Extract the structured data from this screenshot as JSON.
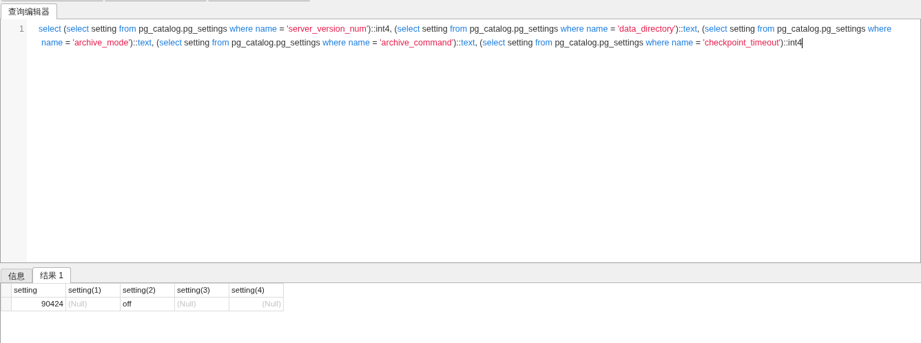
{
  "editor_tabs": [
    {
      "label": "查询编辑器",
      "selected": true
    }
  ],
  "editor": {
    "line_numbers": [
      "1"
    ],
    "lines": [
      [
        {
          "kind": "keyword",
          "text": "select"
        },
        {
          "kind": "plain",
          "text": " ("
        },
        {
          "kind": "keyword",
          "text": "select"
        },
        {
          "kind": "plain",
          "text": " setting "
        },
        {
          "kind": "keyword",
          "text": "from"
        },
        {
          "kind": "plain",
          "text": " pg_catalog.pg_settings "
        },
        {
          "kind": "keyword",
          "text": "where name"
        },
        {
          "kind": "plain",
          "text": " = "
        },
        {
          "kind": "string",
          "text": "'server_version_num'"
        },
        {
          "kind": "plain",
          "text": ")::int4, ("
        },
        {
          "kind": "keyword",
          "text": "select"
        },
        {
          "kind": "plain",
          "text": " setting "
        },
        {
          "kind": "keyword",
          "text": "from"
        },
        {
          "kind": "plain",
          "text": " pg_catalog.pg_settings "
        },
        {
          "kind": "keyword",
          "text": "where name"
        },
        {
          "kind": "plain",
          "text": " = "
        },
        {
          "kind": "string",
          "text": "'data_directory'"
        },
        {
          "kind": "plain",
          "text": ")::"
        },
        {
          "kind": "keyword",
          "text": "text"
        },
        {
          "kind": "plain",
          "text": ", ("
        },
        {
          "kind": "keyword",
          "text": "select"
        },
        {
          "kind": "plain",
          "text": " setting "
        },
        {
          "kind": "keyword",
          "text": "from"
        },
        {
          "kind": "plain",
          "text": " pg_catalog.pg_settings "
        },
        {
          "kind": "keyword",
          "text": "where"
        }
      ],
      [
        {
          "kind": "keyword",
          "text": "name"
        },
        {
          "kind": "plain",
          "text": " = "
        },
        {
          "kind": "string",
          "text": "'archive_mode'"
        },
        {
          "kind": "plain",
          "text": ")::"
        },
        {
          "kind": "keyword",
          "text": "text"
        },
        {
          "kind": "plain",
          "text": ", ("
        },
        {
          "kind": "keyword",
          "text": "select"
        },
        {
          "kind": "plain",
          "text": " setting "
        },
        {
          "kind": "keyword",
          "text": "from"
        },
        {
          "kind": "plain",
          "text": " pg_catalog.pg_settings "
        },
        {
          "kind": "keyword",
          "text": "where name"
        },
        {
          "kind": "plain",
          "text": " = "
        },
        {
          "kind": "string",
          "text": "'archive_command'"
        },
        {
          "kind": "plain",
          "text": ")::"
        },
        {
          "kind": "keyword",
          "text": "text"
        },
        {
          "kind": "plain",
          "text": ", ("
        },
        {
          "kind": "keyword",
          "text": "select"
        },
        {
          "kind": "plain",
          "text": " setting "
        },
        {
          "kind": "keyword",
          "text": "from"
        },
        {
          "kind": "plain",
          "text": " pg_catalog.pg_settings "
        },
        {
          "kind": "keyword",
          "text": "where name"
        },
        {
          "kind": "plain",
          "text": " = "
        },
        {
          "kind": "string",
          "text": "'checkpoint_timeout'"
        },
        {
          "kind": "plain",
          "text": ")::int4"
        }
      ]
    ]
  },
  "result_tabs": [
    {
      "label": "信息",
      "selected": false
    },
    {
      "label": "结果 1",
      "selected": true
    }
  ],
  "table": {
    "columns": [
      {
        "label": "setting",
        "kind": "numeric"
      },
      {
        "label": "setting(1)",
        "kind": "text"
      },
      {
        "label": "setting(2)",
        "kind": "text"
      },
      {
        "label": "setting(3)",
        "kind": "text"
      },
      {
        "label": "setting(4)",
        "kind": "numeric"
      }
    ],
    "rows": [
      [
        {
          "text": "90424",
          "null": false
        },
        {
          "text": "(Null)",
          "null": true
        },
        {
          "text": "off",
          "null": false
        },
        {
          "text": "(Null)",
          "null": true
        },
        {
          "text": "(Null)",
          "null": true
        }
      ]
    ]
  }
}
